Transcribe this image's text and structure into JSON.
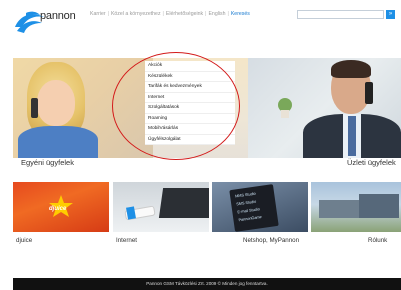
{
  "brand": {
    "name": "pannon"
  },
  "topnav": {
    "items": [
      "Karrier",
      "Közel a környezethez",
      "Elérhetőségeink",
      "English",
      "Keresés"
    ],
    "separator": "|"
  },
  "search": {
    "placeholder": "",
    "button_label": "»"
  },
  "hero": {
    "menu": [
      "Akciók",
      "Készülékek",
      "Tarifák és kedvezmények",
      "Internet",
      "Szolgáltatások",
      "Roaming",
      "MobilVásárlás",
      "Ügyfélszolgálat"
    ],
    "label_left": "Egyéni ügyfelek",
    "label_right": "Üzleti ügyfelek"
  },
  "tiles": [
    {
      "label": "djuice",
      "logo_text": "djuice"
    },
    {
      "label": "Internet"
    },
    {
      "label": "Netshop, MyPannon",
      "card_lines": [
        "MMS Studio",
        "SMS Studio",
        "E-mail Studio",
        "PannonGame"
      ]
    },
    {
      "label": "Rólunk"
    }
  ],
  "footer": {
    "text": "Pannon GSM Távközlési Zrt. 2009 © Minden jog fenntartva."
  },
  "colors": {
    "accent": "#1a7bd0",
    "highlight": "#d31a1a",
    "footer_bg": "#111111"
  }
}
